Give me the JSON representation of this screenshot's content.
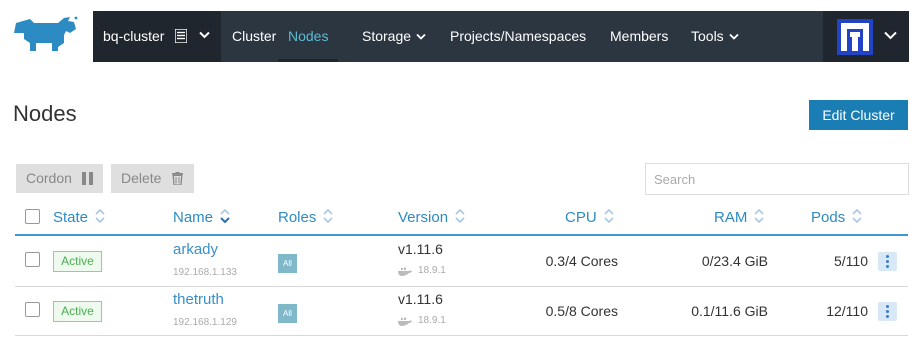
{
  "header": {
    "cluster_name": "bq-cluster",
    "nav_items": [
      "Cluster",
      "Nodes",
      "Storage",
      "Projects/Namespaces",
      "Members",
      "Tools"
    ],
    "active_item": "Nodes"
  },
  "page": {
    "title": "Nodes",
    "edit_cluster_label": "Edit Cluster"
  },
  "toolbar": {
    "cordon_label": "Cordon",
    "delete_label": "Delete",
    "search_placeholder": "Search"
  },
  "table": {
    "columns": [
      "State",
      "Name",
      "Roles",
      "Version",
      "CPU",
      "RAM",
      "Pods"
    ],
    "rows": [
      {
        "state": "Active",
        "name": "arkady",
        "ip": "192.168.1.133",
        "role": "All",
        "version": "v1.11.6",
        "docker": "18.9.1",
        "cpu": "0.3/4 Cores",
        "ram": "0/23.4 GiB",
        "pods": "5/110"
      },
      {
        "state": "Active",
        "name": "thetruth",
        "ip": "192.168.1.129",
        "role": "All",
        "version": "v1.11.6",
        "docker": "18.9.1",
        "cpu": "0.5/8 Cores",
        "ram": "0.1/11.6 GiB",
        "pods": "12/110"
      }
    ]
  },
  "colors": {
    "nav_bg": "#2b3640",
    "nav_active": "#5dbbd1",
    "primary_button": "#1a7db3",
    "link": "#3a8fc7",
    "active_badge": "#4caf50"
  },
  "icons": [
    "rancher-logo-icon",
    "cluster-list-icon",
    "chevron-down-icon",
    "user-avatar-icon",
    "pause-icon",
    "trash-icon",
    "sort-icon",
    "docker-icon",
    "kebab-menu-icon"
  ]
}
